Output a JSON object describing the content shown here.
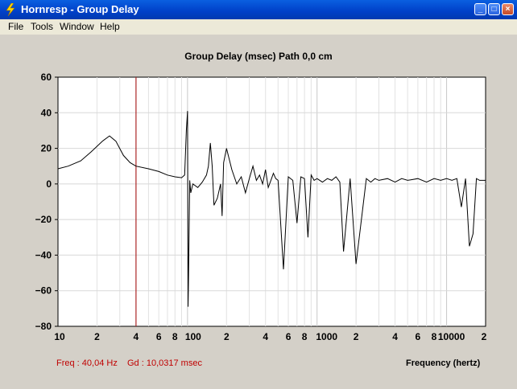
{
  "window": {
    "title": "Hornresp - Group Delay"
  },
  "menu": [
    "File",
    "Tools",
    "Window",
    "Help"
  ],
  "chart_data": {
    "type": "line",
    "title": "Group Delay (msec)   Path 0,0 cm",
    "xlabel": "Frequency (hertz)",
    "x_scale": "log",
    "xlim": [
      10,
      20000
    ],
    "ylim": [
      -80,
      60
    ],
    "ytick_labels": [
      "60",
      "40",
      "20",
      "0",
      "−20",
      "−40",
      "−60",
      "−80"
    ],
    "xtick_labels": [
      "10",
      "2",
      "4",
      "6",
      "8",
      "100",
      "2",
      "4",
      "6",
      "8",
      "1000",
      "2",
      "4",
      "6",
      "8",
      "10000",
      "2"
    ],
    "marker_x": 40.04,
    "grid": true,
    "series": [
      {
        "values_desc": "",
        "x": [
          10,
          12,
          15,
          18,
          22,
          25,
          28,
          32,
          36,
          40,
          50,
          60,
          70,
          80,
          90,
          95,
          98,
          100,
          101,
          102,
          104,
          106,
          110,
          120,
          130,
          140,
          145,
          150,
          155,
          160,
          170,
          180,
          185,
          190,
          200,
          220,
          240,
          260,
          280,
          300,
          320,
          340,
          360,
          380,
          400,
          420,
          440,
          460,
          480,
          500,
          550,
          600,
          650,
          700,
          750,
          800,
          850,
          900,
          950,
          1000,
          1100,
          1200,
          1300,
          1400,
          1500,
          1600,
          1800,
          2000,
          2200,
          2400,
          2600,
          2800,
          3000,
          3500,
          4000,
          4500,
          5000,
          6000,
          7000,
          8000,
          9000,
          10000,
          11000,
          12000,
          13000,
          14000,
          15000,
          16000,
          17000,
          18000,
          20000
        ],
        "y": [
          8.5,
          10,
          13,
          18,
          24,
          27,
          24,
          16,
          12,
          10,
          8.5,
          7,
          5,
          4,
          3.5,
          5,
          30,
          41,
          -69,
          -50,
          2,
          -5,
          0,
          -2,
          1,
          5,
          10,
          23,
          10,
          -12,
          -8,
          0,
          -18,
          12,
          20,
          8,
          0,
          4,
          -5,
          3,
          10,
          2,
          5,
          0,
          8,
          -2,
          2,
          6,
          3,
          2,
          -48,
          4,
          2,
          -22,
          4,
          3,
          -30,
          5,
          2,
          3,
          1,
          3,
          2,
          4,
          1,
          -38,
          3,
          -45,
          -20,
          3,
          1,
          3,
          2,
          3,
          1,
          3,
          2,
          3,
          1,
          3,
          2,
          3,
          2,
          3,
          -13,
          3,
          -35,
          -28,
          3,
          2,
          2
        ]
      }
    ]
  },
  "status": {
    "freq": "Freq : 40,04 Hz",
    "gd": "Gd : 10,0317 msec"
  }
}
